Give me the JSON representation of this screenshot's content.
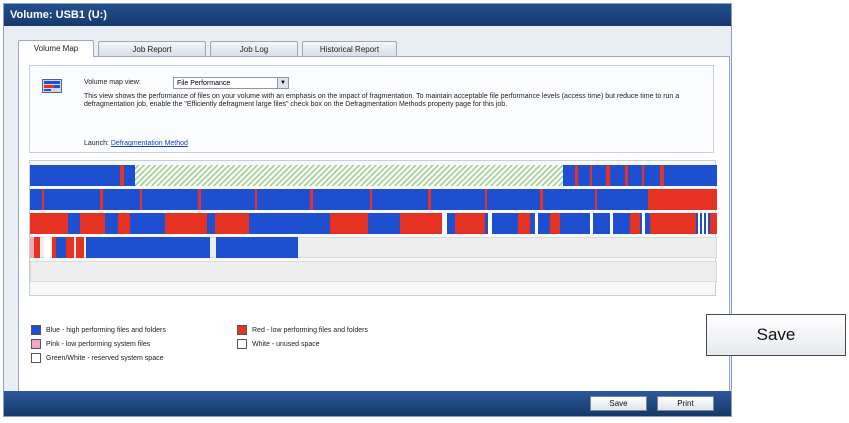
{
  "window": {
    "title": "Volume: USB1 (U:)"
  },
  "tabs": [
    {
      "label": "Volume Map",
      "active": true
    },
    {
      "label": "Job Report",
      "active": false
    },
    {
      "label": "Job Log",
      "active": false
    },
    {
      "label": "Historical Report",
      "active": false
    }
  ],
  "view": {
    "label": "Volume map view:",
    "selected": "File Performance",
    "description": "This view shows the performance of files on your volume with an emphasis on the impact of fragmentation. To maintain acceptable file performance levels (access time) but reduce time to run a defragmentation job, enable the \"Efficiently defragment large files\" check box on the Defragmentation Methods property page for this job.",
    "launch_label": "Launch:",
    "launch_link": "Defragmentation Method"
  },
  "legend": [
    {
      "label": "Blue - high performing files and folders",
      "color": "#1d4fd0"
    },
    {
      "label": "Pink - low performing system files",
      "color": "#f3a6c0"
    },
    {
      "label": "Green/White - reserved system space",
      "color": "#ffffff"
    },
    {
      "label": "Red - low performing files and folders",
      "color": "#e53222"
    },
    {
      "label": "White - unused space",
      "color": "#ffffff"
    }
  ],
  "buttons": {
    "save": "Save",
    "print": "Print",
    "save_large": "Save"
  },
  "colors": {
    "blue": "#1d4fd0",
    "red": "#e53222",
    "reserved": "#cfe8c6",
    "empty": "#eeeeee"
  }
}
